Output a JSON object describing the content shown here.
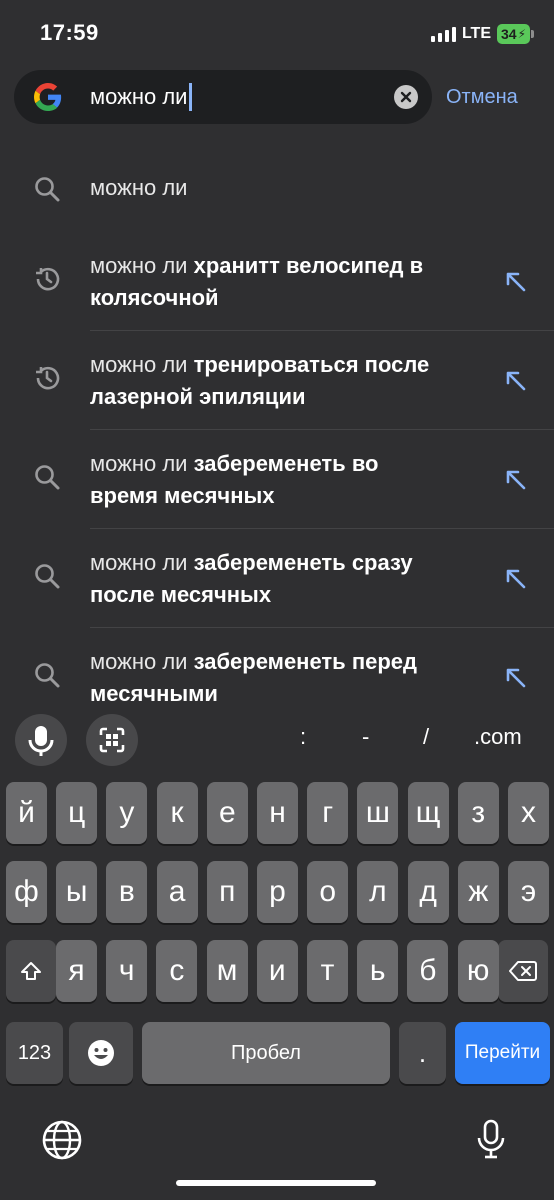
{
  "status_bar": {
    "time": "17:59",
    "network": "LTE",
    "battery": "34"
  },
  "search": {
    "query": "можно ли",
    "cancel_label": "Отмена"
  },
  "suggestions": [
    {
      "type": "search",
      "prefix": "можно ли",
      "lines": [
        ""
      ]
    },
    {
      "type": "history",
      "prefix": "можно ли",
      "lines": [
        "хранитт велосипед в",
        "колясочной"
      ]
    },
    {
      "type": "history",
      "prefix": "можно ли",
      "lines": [
        "тренироваться после",
        "лазерной эпиляции"
      ]
    },
    {
      "type": "search",
      "prefix": "можно ли",
      "lines": [
        "забеременеть во",
        "время месячных"
      ]
    },
    {
      "type": "search",
      "prefix": "можно ли",
      "lines": [
        "забеременеть сразу",
        "после месячных"
      ]
    },
    {
      "type": "search",
      "prefix": "можно ли",
      "lines": [
        "забеременеть перед",
        "месячными"
      ]
    }
  ],
  "toolbar": {
    "symbols": [
      ":",
      "-",
      "/",
      ".com"
    ]
  },
  "keyboard": {
    "row1": [
      "й",
      "ц",
      "у",
      "к",
      "е",
      "н",
      "г",
      "ш",
      "щ",
      "з",
      "х"
    ],
    "row2": [
      "ф",
      "ы",
      "в",
      "а",
      "п",
      "р",
      "о",
      "л",
      "д",
      "ж",
      "э"
    ],
    "row3": [
      "я",
      "ч",
      "с",
      "м",
      "и",
      "т",
      "ь",
      "б",
      "ю"
    ],
    "numbers_label": "123",
    "space_label": "Пробел",
    "period_label": ".",
    "go_label": "Перейти"
  },
  "icons": {
    "search": "search-icon",
    "history": "history-icon",
    "arrow": "fill-arrow-icon",
    "mic": "mic-icon",
    "lens": "lens-icon",
    "shift": "shift-icon",
    "backspace": "backspace-icon",
    "emoji": "emoji-icon",
    "globe": "globe-icon",
    "dictation": "dictation-mic-icon"
  },
  "colors": {
    "accent": "#8ab4f8",
    "go_button": "#2f7ff5",
    "background": "#2f2f31"
  }
}
